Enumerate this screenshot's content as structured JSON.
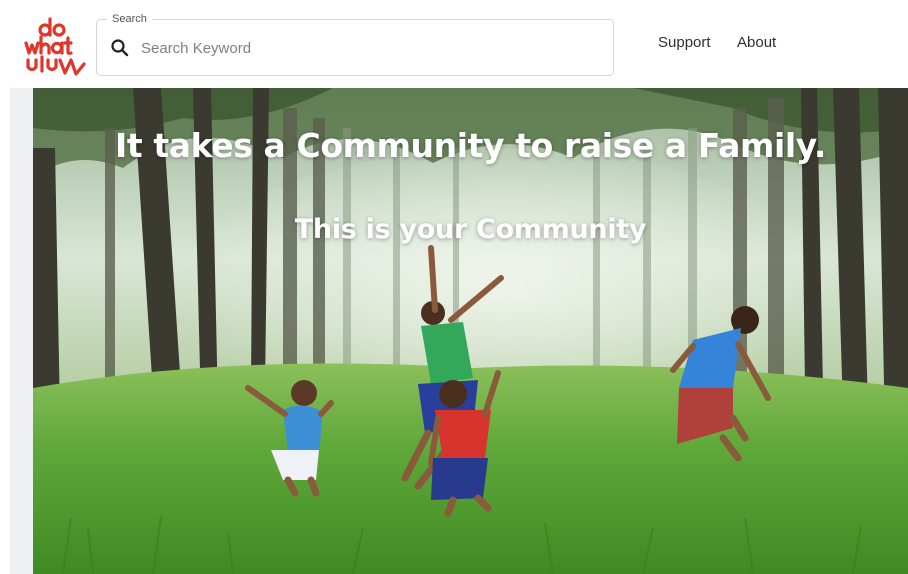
{
  "brand": {
    "logo_text": "do what u luv",
    "logo_color": "#e0352b"
  },
  "search": {
    "legend": "Search",
    "placeholder": "Search Keyword",
    "value": ""
  },
  "nav": {
    "support": "Support",
    "about": "About"
  },
  "hero": {
    "title": "It takes a Community to raise a Family.",
    "subtitle": "This is your Community",
    "image_description_icon": "photo-children-jumping-in-forest"
  },
  "colors": {
    "accent": "#e0352b",
    "text": "#2f2f2f",
    "grass": "#5fa83a",
    "forest": "#cfe0cc"
  }
}
